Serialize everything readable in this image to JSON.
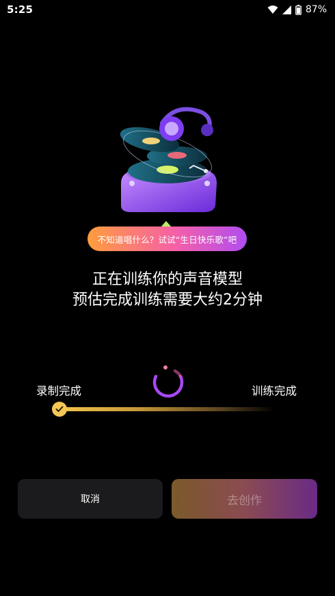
{
  "status_bar": {
    "time": "5:25",
    "battery_percent": "87%",
    "icons": [
      "wifi-icon",
      "signal-icon",
      "battery-icon"
    ]
  },
  "illustration": {
    "icon": "turntable-headphones-icon"
  },
  "tooltip": {
    "text": "不知道唱什么？试试“生日快乐歌”吧"
  },
  "title": {
    "line1": "正在训练你的声音模型",
    "line2": "预估完成训练需要大约2分钟"
  },
  "progress": {
    "start_label": "录制完成",
    "end_label": "训练完成",
    "spinner_icon": "loading-spinner-icon",
    "check_icon": "check-icon"
  },
  "buttons": {
    "cancel_label": "取消",
    "create_label": "去创作"
  },
  "colors": {
    "background": "#000000",
    "accent_purple": "#b04df0",
    "accent_yellow": "#f4c654",
    "accent_orange": "#ff9d3c"
  }
}
